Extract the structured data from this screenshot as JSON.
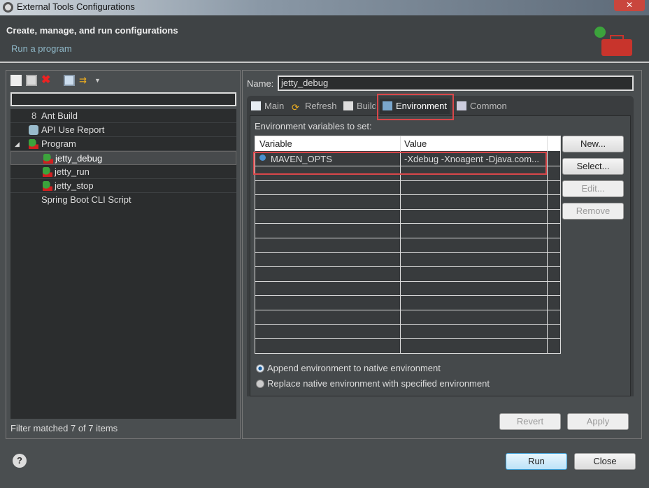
{
  "window": {
    "title": "External Tools Configurations",
    "close_icon": "✕"
  },
  "header": {
    "title": "Create, manage, and run configurations",
    "subtitle": "Run a program"
  },
  "left": {
    "toolbar": [
      "new-launch-config-icon",
      "duplicate-icon",
      "delete-icon",
      "collapse-all-icon",
      "filter-icon"
    ],
    "filter_value": "",
    "tree": [
      {
        "label": "Ant Build",
        "level": 1,
        "icon": "ant-icon"
      },
      {
        "label": "API Use Report",
        "level": 1,
        "icon": "api-report-icon"
      },
      {
        "label": "Program",
        "level": 1,
        "icon": "program-icon",
        "expanded": true
      },
      {
        "label": "jetty_debug",
        "level": 2,
        "icon": "program-icon",
        "selected": true
      },
      {
        "label": "jetty_run",
        "level": 2,
        "icon": "program-icon"
      },
      {
        "label": "jetty_stop",
        "level": 2,
        "icon": "program-icon"
      },
      {
        "label": "Spring Boot CLI Script",
        "level": 1,
        "icon": ""
      }
    ],
    "status": "Filter matched 7 of 7 items"
  },
  "right": {
    "name_label": "Name:",
    "name_value": "jetty_debug",
    "tabs": [
      "Main",
      "Refresh",
      "Build",
      "Environment",
      "Common"
    ],
    "active_tab": "Environment",
    "env_label": "Environment variables to set:",
    "columns": [
      "Variable",
      "Value"
    ],
    "rows": [
      {
        "variable": "MAVEN_OPTS",
        "value": "-Xdebug -Xnoagent -Djava.com..."
      }
    ],
    "buttons": {
      "new": "New...",
      "select": "Select...",
      "edit": "Edit...",
      "remove": "Remove"
    },
    "radio_append": "Append environment to native environment",
    "radio_replace": "Replace native environment with specified environment",
    "selected_radio": "append",
    "revert": "Revert",
    "apply": "Apply"
  },
  "footer": {
    "help": "?",
    "run": "Run",
    "close": "Close"
  },
  "colors": {
    "highlight": "#d9474a",
    "accent": "#3c9fd6"
  }
}
